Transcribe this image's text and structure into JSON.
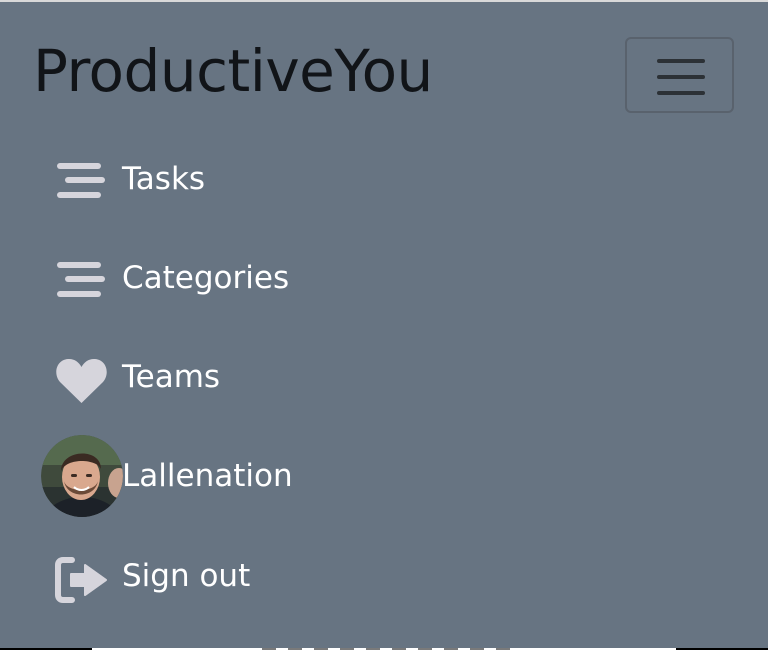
{
  "brand": {
    "title": "ProductiveYou"
  },
  "toggler": {
    "icon": "hamburger-icon",
    "aria_label": "Toggle navigation"
  },
  "nav": {
    "items": [
      {
        "label": "Tasks",
        "icon": "list-icon"
      },
      {
        "label": "Categories",
        "icon": "list-icon"
      },
      {
        "label": "Teams",
        "icon": "heart-icon"
      },
      {
        "label": "Lallenation",
        "icon": "avatar"
      },
      {
        "label": "Sign out",
        "icon": "sign-out-icon"
      }
    ]
  },
  "colors": {
    "navbar_bg": "#677482",
    "brand_text": "#111418",
    "item_text": "#ffffff",
    "icon_fill": "#d6d5dc",
    "toggler_border": "#59626d",
    "toggler_bars": "#2c3136"
  }
}
